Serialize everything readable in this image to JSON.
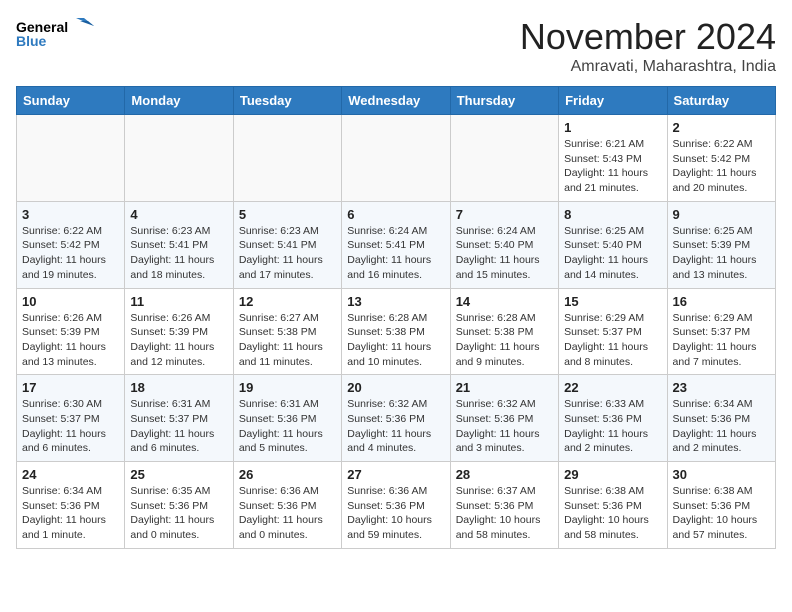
{
  "header": {
    "logo_general": "General",
    "logo_blue": "Blue",
    "month_title": "November 2024",
    "location": "Amravati, Maharashtra, India"
  },
  "days_of_week": [
    "Sunday",
    "Monday",
    "Tuesday",
    "Wednesday",
    "Thursday",
    "Friday",
    "Saturday"
  ],
  "weeks": [
    [
      {
        "day": "",
        "info": ""
      },
      {
        "day": "",
        "info": ""
      },
      {
        "day": "",
        "info": ""
      },
      {
        "day": "",
        "info": ""
      },
      {
        "day": "",
        "info": ""
      },
      {
        "day": "1",
        "info": "Sunrise: 6:21 AM\nSunset: 5:43 PM\nDaylight: 11 hours and 21 minutes."
      },
      {
        "day": "2",
        "info": "Sunrise: 6:22 AM\nSunset: 5:42 PM\nDaylight: 11 hours and 20 minutes."
      }
    ],
    [
      {
        "day": "3",
        "info": "Sunrise: 6:22 AM\nSunset: 5:42 PM\nDaylight: 11 hours and 19 minutes."
      },
      {
        "day": "4",
        "info": "Sunrise: 6:23 AM\nSunset: 5:41 PM\nDaylight: 11 hours and 18 minutes."
      },
      {
        "day": "5",
        "info": "Sunrise: 6:23 AM\nSunset: 5:41 PM\nDaylight: 11 hours and 17 minutes."
      },
      {
        "day": "6",
        "info": "Sunrise: 6:24 AM\nSunset: 5:41 PM\nDaylight: 11 hours and 16 minutes."
      },
      {
        "day": "7",
        "info": "Sunrise: 6:24 AM\nSunset: 5:40 PM\nDaylight: 11 hours and 15 minutes."
      },
      {
        "day": "8",
        "info": "Sunrise: 6:25 AM\nSunset: 5:40 PM\nDaylight: 11 hours and 14 minutes."
      },
      {
        "day": "9",
        "info": "Sunrise: 6:25 AM\nSunset: 5:39 PM\nDaylight: 11 hours and 13 minutes."
      }
    ],
    [
      {
        "day": "10",
        "info": "Sunrise: 6:26 AM\nSunset: 5:39 PM\nDaylight: 11 hours and 13 minutes."
      },
      {
        "day": "11",
        "info": "Sunrise: 6:26 AM\nSunset: 5:39 PM\nDaylight: 11 hours and 12 minutes."
      },
      {
        "day": "12",
        "info": "Sunrise: 6:27 AM\nSunset: 5:38 PM\nDaylight: 11 hours and 11 minutes."
      },
      {
        "day": "13",
        "info": "Sunrise: 6:28 AM\nSunset: 5:38 PM\nDaylight: 11 hours and 10 minutes."
      },
      {
        "day": "14",
        "info": "Sunrise: 6:28 AM\nSunset: 5:38 PM\nDaylight: 11 hours and 9 minutes."
      },
      {
        "day": "15",
        "info": "Sunrise: 6:29 AM\nSunset: 5:37 PM\nDaylight: 11 hours and 8 minutes."
      },
      {
        "day": "16",
        "info": "Sunrise: 6:29 AM\nSunset: 5:37 PM\nDaylight: 11 hours and 7 minutes."
      }
    ],
    [
      {
        "day": "17",
        "info": "Sunrise: 6:30 AM\nSunset: 5:37 PM\nDaylight: 11 hours and 6 minutes."
      },
      {
        "day": "18",
        "info": "Sunrise: 6:31 AM\nSunset: 5:37 PM\nDaylight: 11 hours and 6 minutes."
      },
      {
        "day": "19",
        "info": "Sunrise: 6:31 AM\nSunset: 5:36 PM\nDaylight: 11 hours and 5 minutes."
      },
      {
        "day": "20",
        "info": "Sunrise: 6:32 AM\nSunset: 5:36 PM\nDaylight: 11 hours and 4 minutes."
      },
      {
        "day": "21",
        "info": "Sunrise: 6:32 AM\nSunset: 5:36 PM\nDaylight: 11 hours and 3 minutes."
      },
      {
        "day": "22",
        "info": "Sunrise: 6:33 AM\nSunset: 5:36 PM\nDaylight: 11 hours and 2 minutes."
      },
      {
        "day": "23",
        "info": "Sunrise: 6:34 AM\nSunset: 5:36 PM\nDaylight: 11 hours and 2 minutes."
      }
    ],
    [
      {
        "day": "24",
        "info": "Sunrise: 6:34 AM\nSunset: 5:36 PM\nDaylight: 11 hours and 1 minute."
      },
      {
        "day": "25",
        "info": "Sunrise: 6:35 AM\nSunset: 5:36 PM\nDaylight: 11 hours and 0 minutes."
      },
      {
        "day": "26",
        "info": "Sunrise: 6:36 AM\nSunset: 5:36 PM\nDaylight: 11 hours and 0 minutes."
      },
      {
        "day": "27",
        "info": "Sunrise: 6:36 AM\nSunset: 5:36 PM\nDaylight: 10 hours and 59 minutes."
      },
      {
        "day": "28",
        "info": "Sunrise: 6:37 AM\nSunset: 5:36 PM\nDaylight: 10 hours and 58 minutes."
      },
      {
        "day": "29",
        "info": "Sunrise: 6:38 AM\nSunset: 5:36 PM\nDaylight: 10 hours and 58 minutes."
      },
      {
        "day": "30",
        "info": "Sunrise: 6:38 AM\nSunset: 5:36 PM\nDaylight: 10 hours and 57 minutes."
      }
    ]
  ]
}
